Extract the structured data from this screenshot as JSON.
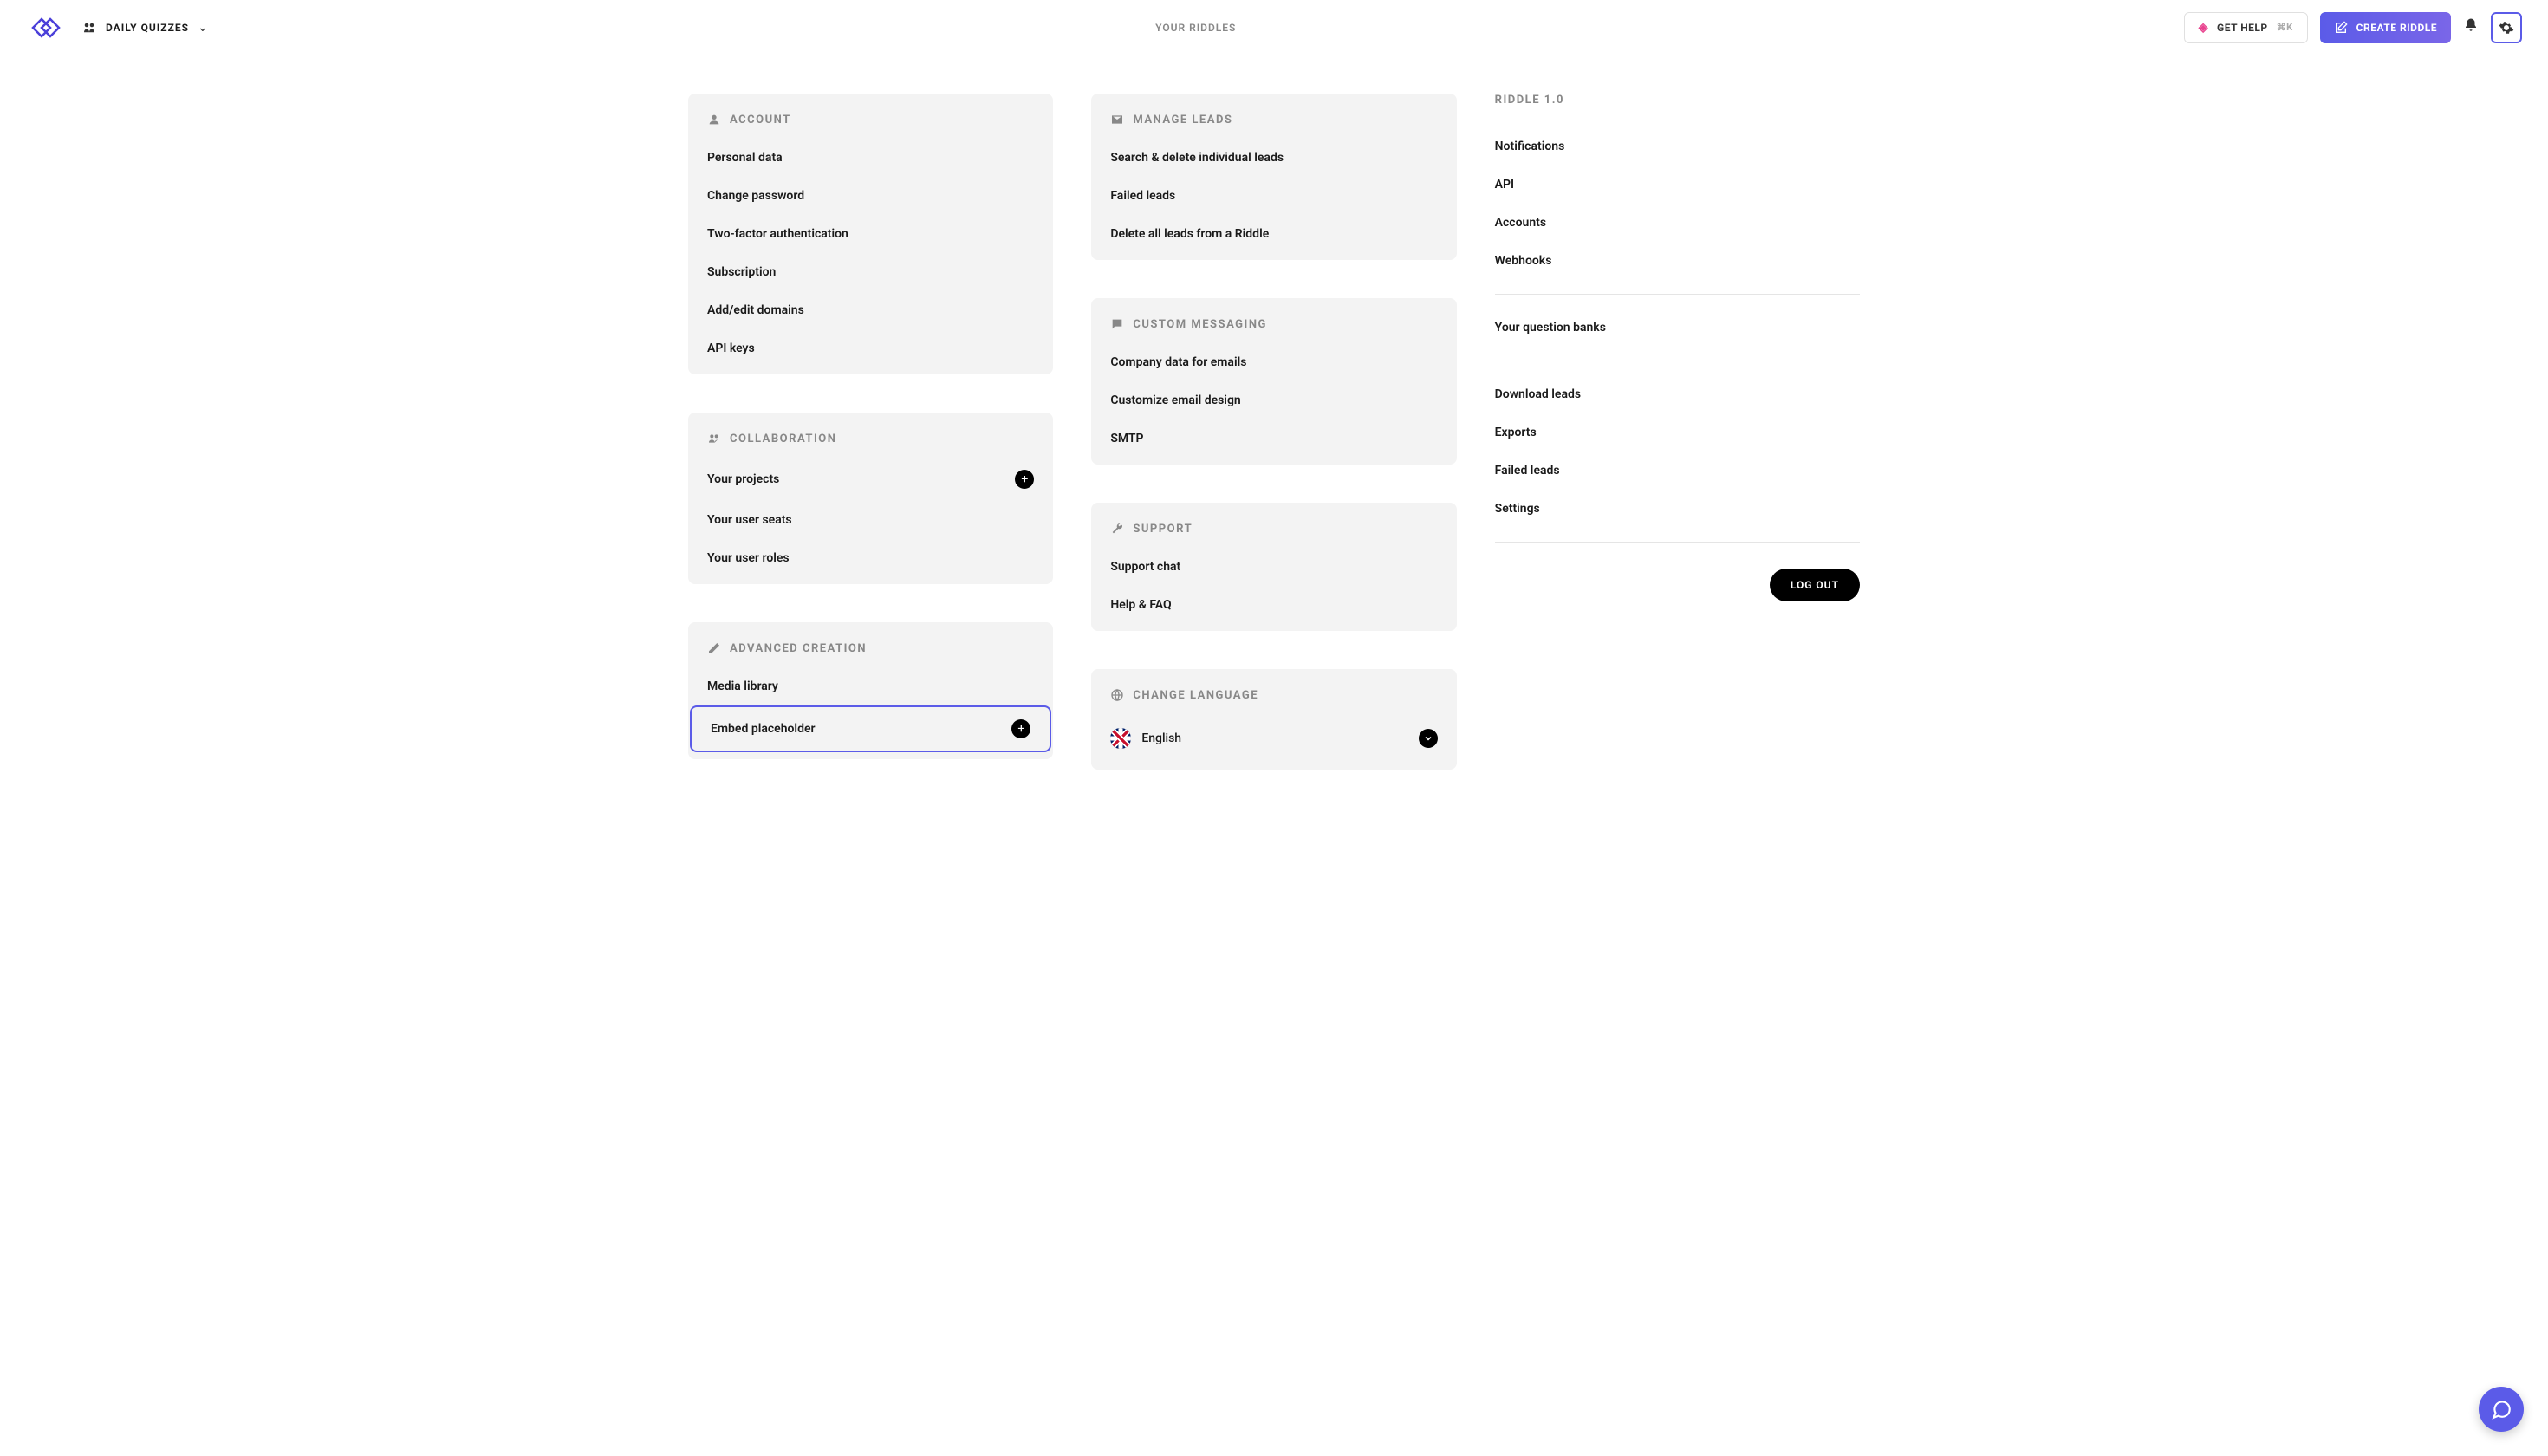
{
  "topbar": {
    "workspace_label": "DAILY QUIZZES",
    "center_title": "YOUR RIDDLES",
    "help_label": "GET HELP",
    "help_shortcut": "⌘K",
    "create_label": "CREATE RIDDLE"
  },
  "col1": {
    "sections": [
      {
        "title": "ACCOUNT",
        "items": [
          "Personal data",
          "Change password",
          "Two-factor authentication",
          "Subscription",
          "Add/edit domains",
          "API keys"
        ]
      },
      {
        "title": "COLLABORATION",
        "items": [
          "Your projects",
          "Your user seats",
          "Your user roles"
        ]
      },
      {
        "title": "ADVANCED CREATION",
        "items": [
          "Media library",
          "Embed placeholder"
        ]
      }
    ]
  },
  "col2": {
    "sections": [
      {
        "title": "MANAGE LEADS",
        "items": [
          "Search & delete individual leads",
          "Failed leads",
          "Delete all leads from a Riddle"
        ]
      },
      {
        "title": "CUSTOM MESSAGING",
        "items": [
          "Company data for emails",
          "Customize email design",
          "SMTP"
        ]
      },
      {
        "title": "SUPPORT",
        "items": [
          "Support chat",
          "Help & FAQ"
        ]
      },
      {
        "title": "CHANGE LANGUAGE",
        "language": "English"
      }
    ]
  },
  "col3": {
    "section_title": "RIDDLE 1.0",
    "group1": [
      "Notifications",
      "API",
      "Accounts",
      "Webhooks"
    ],
    "group2": [
      "Your question banks"
    ],
    "group3": [
      "Download leads",
      "Exports",
      "Failed leads",
      "Settings"
    ],
    "logout_label": "LOG OUT"
  }
}
